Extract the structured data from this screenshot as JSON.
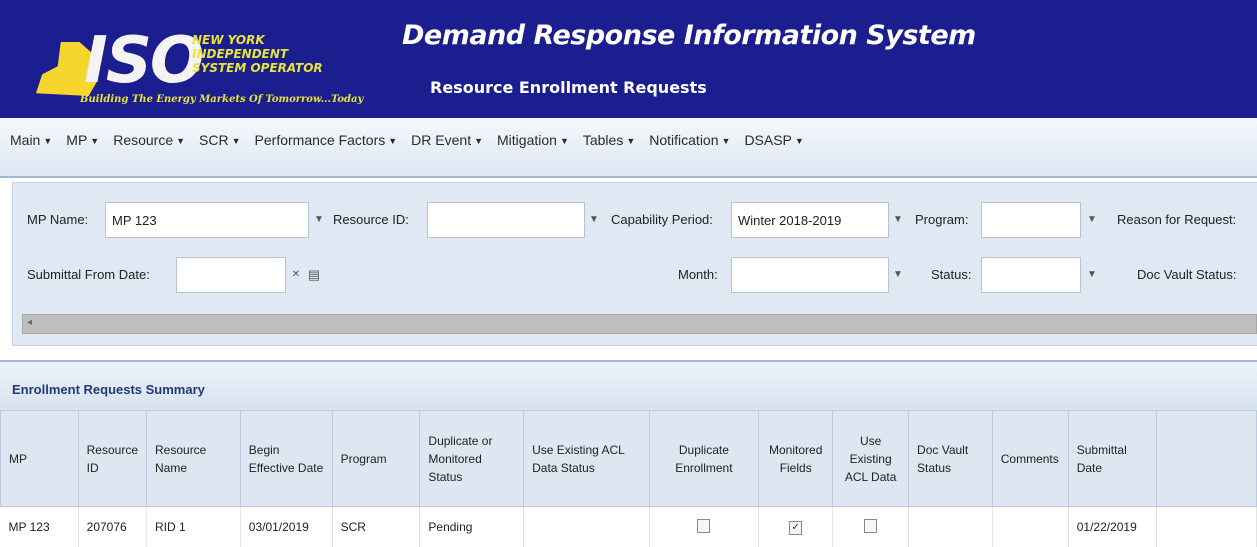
{
  "header": {
    "logo_text": "ISO",
    "org_lines": [
      "NEW YORK",
      "INDEPENDENT",
      "SYSTEM OPERATOR"
    ],
    "tagline": "Building The Energy Markets Of Tomorrow...Today",
    "app_title": "Demand Response Information System",
    "page_title": "Resource Enrollment Requests"
  },
  "menu": [
    {
      "label": "Main"
    },
    {
      "label": "MP"
    },
    {
      "label": "Resource"
    },
    {
      "label": "SCR"
    },
    {
      "label": "Performance Factors"
    },
    {
      "label": "DR Event"
    },
    {
      "label": "Mitigation"
    },
    {
      "label": "Tables"
    },
    {
      "label": "Notification"
    },
    {
      "label": "DSASP"
    }
  ],
  "filters": {
    "mp_name_label": "MP Name:",
    "mp_name_value": "MP 123",
    "resource_id_label": "Resource ID:",
    "resource_id_value": "",
    "capability_period_label": "Capability Period:",
    "capability_period_value": "Winter 2018-2019",
    "program_label": "Program:",
    "program_value": "",
    "reason_label": "Reason for Request:",
    "submittal_from_label": "Submittal From Date:",
    "submittal_from_value": "",
    "month_label": "Month:",
    "month_value": "",
    "status_label": "Status:",
    "status_value": "",
    "doc_vault_label": "Doc Vault Status:"
  },
  "summary": {
    "title": "Enrollment Requests Summary",
    "columns": [
      "MP",
      "Resource ID",
      "Resource Name",
      "Begin Effective Date",
      "Program",
      "Duplicate or Monitored Status",
      "Use Existing ACL Data Status",
      "Duplicate Enrollment",
      "Monitored Fields",
      "Use Existing ACL Data",
      "Doc Vault Status",
      "Comments",
      "Submittal Date"
    ],
    "rows": [
      {
        "mp": "MP 123",
        "resource_id": "207076",
        "resource_name": "RID 1",
        "begin_date": "03/01/2019",
        "program": "SCR",
        "dup_status": "Pending",
        "acl_status": "",
        "duplicate_enrollment": false,
        "monitored_fields": true,
        "use_existing_acl": false,
        "doc_vault_status": "",
        "comments": "",
        "submittal_date": "01/22/2019"
      }
    ]
  },
  "colors": {
    "header_bg": "#1b1e8f",
    "accent_yellow": "#f6d52c",
    "filter_bg": "#dfe8f3",
    "table_header_bg": "#dde6f1",
    "summary_title": "#1f3c78"
  },
  "icons": {
    "dropdown": "chevron-down-icon",
    "clear": "clear-icon",
    "calendar": "calendar-icon",
    "scroll_left": "arrow-left-icon"
  }
}
